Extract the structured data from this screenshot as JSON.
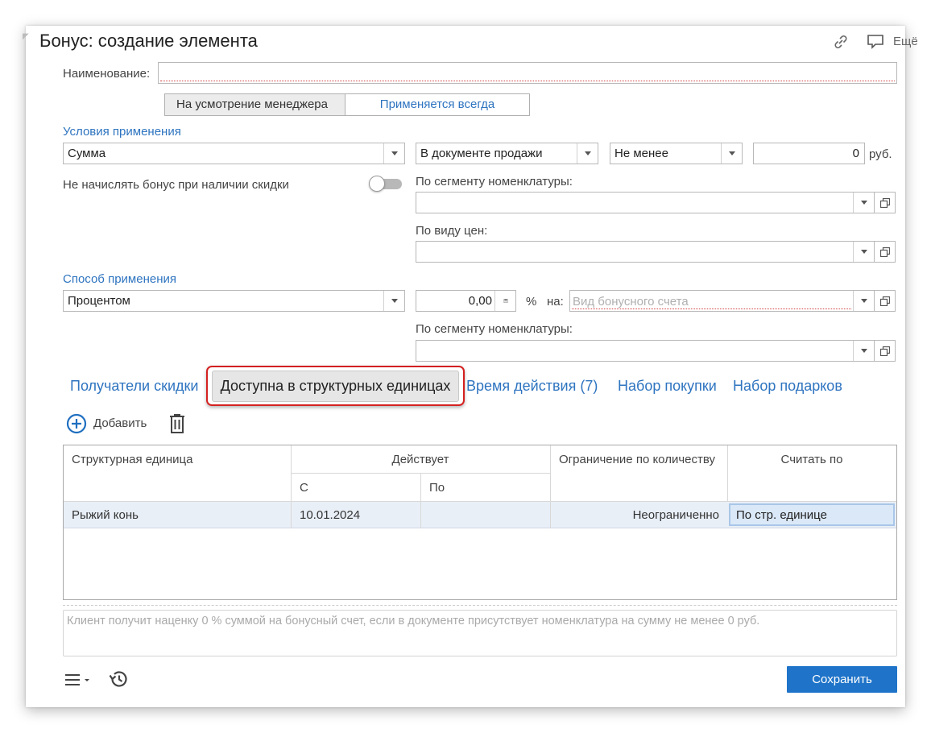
{
  "window": {
    "title": "Бонус: создание элемента",
    "more_label": "Ещё"
  },
  "form": {
    "name_label": "Наименование:",
    "name_value": "",
    "mode_options": [
      "На усмотрение менеджера",
      "Применяется всегда"
    ],
    "mode_selected": "Применяется всегда",
    "conditions_header": "Условия применения",
    "condition_type": "Сумма",
    "condition_doc": "В документе продажи",
    "condition_compare": "Не менее",
    "condition_amount": "0",
    "currency": "руб.",
    "no_bonus_with_discount_label": "Не начислять бонус при наличии скидки",
    "no_bonus_with_discount_on": false,
    "nomenclature_segment_label": "По сегменту номенклатуры:",
    "nomenclature_segment_value": "",
    "price_type_label": "По виду цен:",
    "price_type_value": "",
    "method_header": "Способ применения",
    "method_value": "Процентом",
    "percent_value": "0,00",
    "percent_sign": "%",
    "on_label": "на:",
    "bonus_account_placeholder": "Вид бонусного счета",
    "method_segment_label": "По сегменту номенклатуры:",
    "method_segment_value": ""
  },
  "tabs": [
    {
      "label": "Получатели скидки",
      "active": false
    },
    {
      "label": "Доступна в структурных единицах",
      "active": true
    },
    {
      "label": "Время действия (7)",
      "active": false
    },
    {
      "label": "Набор покупки",
      "active": false
    },
    {
      "label": "Набор подарков",
      "active": false
    }
  ],
  "toolbar": {
    "add_label": "Добавить"
  },
  "table": {
    "columns": {
      "unit": "Структурная единица",
      "active": "Действует",
      "from": "С",
      "to": "По",
      "limit": "Ограничение по количеству",
      "count_by": "Считать по"
    },
    "rows": [
      {
        "unit": "Рыжий конь",
        "from": "10.01.2024",
        "to": "",
        "limit": "Неограниченно",
        "count_by": "По стр. единице"
      }
    ]
  },
  "info_text": "Клиент получит наценку 0 % суммой на бонусный счет, если в документе присутствует номенклатура на сумму не менее 0 руб.",
  "footer": {
    "save_label": "Сохранить"
  },
  "colors": {
    "accent": "#2e74c0",
    "primary_button": "#1f74c9",
    "highlight_border": "#d42020",
    "selected_row": "#e9eff7"
  },
  "icons": [
    "link-icon",
    "comment-icon",
    "add-circle-icon",
    "trash-icon",
    "menu-icon",
    "history-icon",
    "calculator-icon",
    "dropdown-arrow-icon",
    "open-icon"
  ]
}
